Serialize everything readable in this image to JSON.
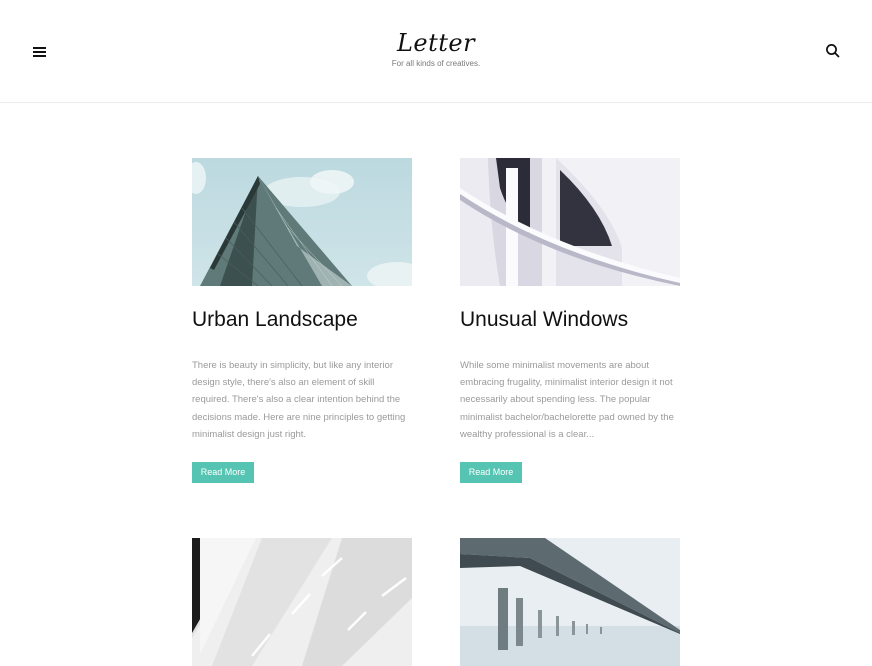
{
  "header": {
    "logo": "Letter",
    "tagline": "For all kinds of creatives."
  },
  "posts": [
    {
      "title": "Urban Landscape",
      "excerpt": "There is beauty in simplicity, but like any interior design style, there's also an element of skill required. There's also a clear intention behind the decisions made. Here are nine principles to getting minimalist design just right.",
      "read_more": "Read More"
    },
    {
      "title": "Unusual Windows",
      "excerpt": "While some minimalist movements are about embracing frugality, minimalist interior design it not necessarily about spending less. The popular minimalist bachelor/bachelorette pad owned by the wealthy professional is a clear...",
      "read_more": "Read More"
    }
  ],
  "colors": {
    "accent": "#55c4b2",
    "text": "#111111",
    "muted": "#9a9a9a"
  },
  "icons": {
    "menu": "hamburger-menu-icon",
    "search": "search-icon"
  }
}
